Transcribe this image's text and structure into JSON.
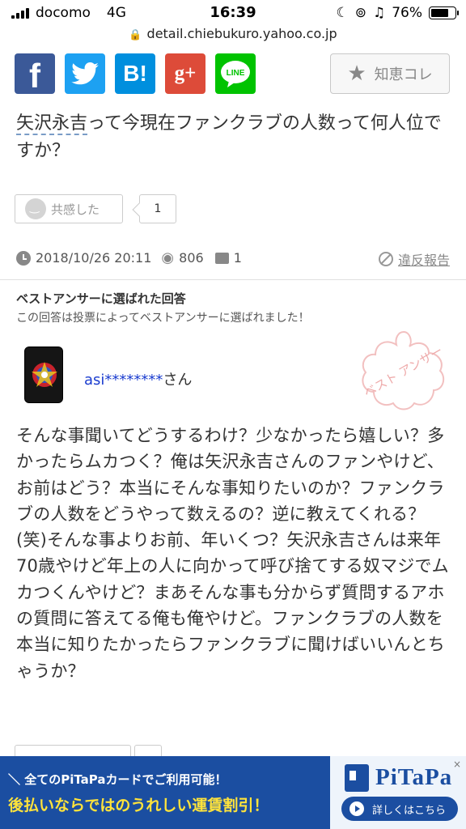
{
  "status_bar": {
    "carrier": "docomo",
    "network": "4G",
    "time": "16:39",
    "battery": "76%",
    "battery_level": 0.76
  },
  "url": "detail.chiebukuro.yahoo.co.jp",
  "share": {
    "facebook": "f",
    "hatena": "B!",
    "googleplus": "g+",
    "line": "LINE"
  },
  "chie_kore_label": "知恵コレ",
  "question": {
    "keyword": "矢沢永吉",
    "rest": "って今現在ファンクラブの人数って何人位ですか？"
  },
  "empathy": {
    "label": "共感した",
    "count": "1"
  },
  "meta": {
    "datetime": "2018/10/26 20:11",
    "views": "806",
    "comments": "1",
    "report": "違反報告"
  },
  "best_answer": {
    "heading": "ベストアンサーに選ばれた回答",
    "subtext": "この回答は投票によってベストアンサーに選ばれました！",
    "stamp_text": "ベスト アンサー",
    "username": "asi********",
    "honorific": "さん",
    "body": "そんな事聞いてどうするわけ？少なかったら嬉しい？多かったらムカつく？俺は矢沢永吉さんのファンやけど、お前はどう？本当にそんな事知りたいのか？ファンクラブの人数をどうやって数えるの？逆に教えてくれる？(笑)そんな事よりお前、年いくつ？矢沢永吉さんは来年70歳やけど年上の人に向かって呼び捨てする奴マジでムカつくんやけど？まあそんな事も分からず質問するアホの質問に答えてる俺も俺やけど。ファンクラブの人数を本当に知りたかったらファンクラブに聞けばいいんとちゃうか？"
  },
  "ad": {
    "line1": "＼ 全てのPiTaPaカードでご利用可能！",
    "line2": "後払いならではのうれしい運賃割引！",
    "brand": "PiTaPa",
    "cta": "詳しくはこちら",
    "close": "×"
  },
  "colors": {
    "facebook": "#3b5998",
    "twitter": "#1da1f2",
    "hatena": "#008fde",
    "googleplus": "#dd4b39",
    "line": "#00c300",
    "ad_bg": "#1b4ea1",
    "ad_highlight": "#ffe33b"
  }
}
